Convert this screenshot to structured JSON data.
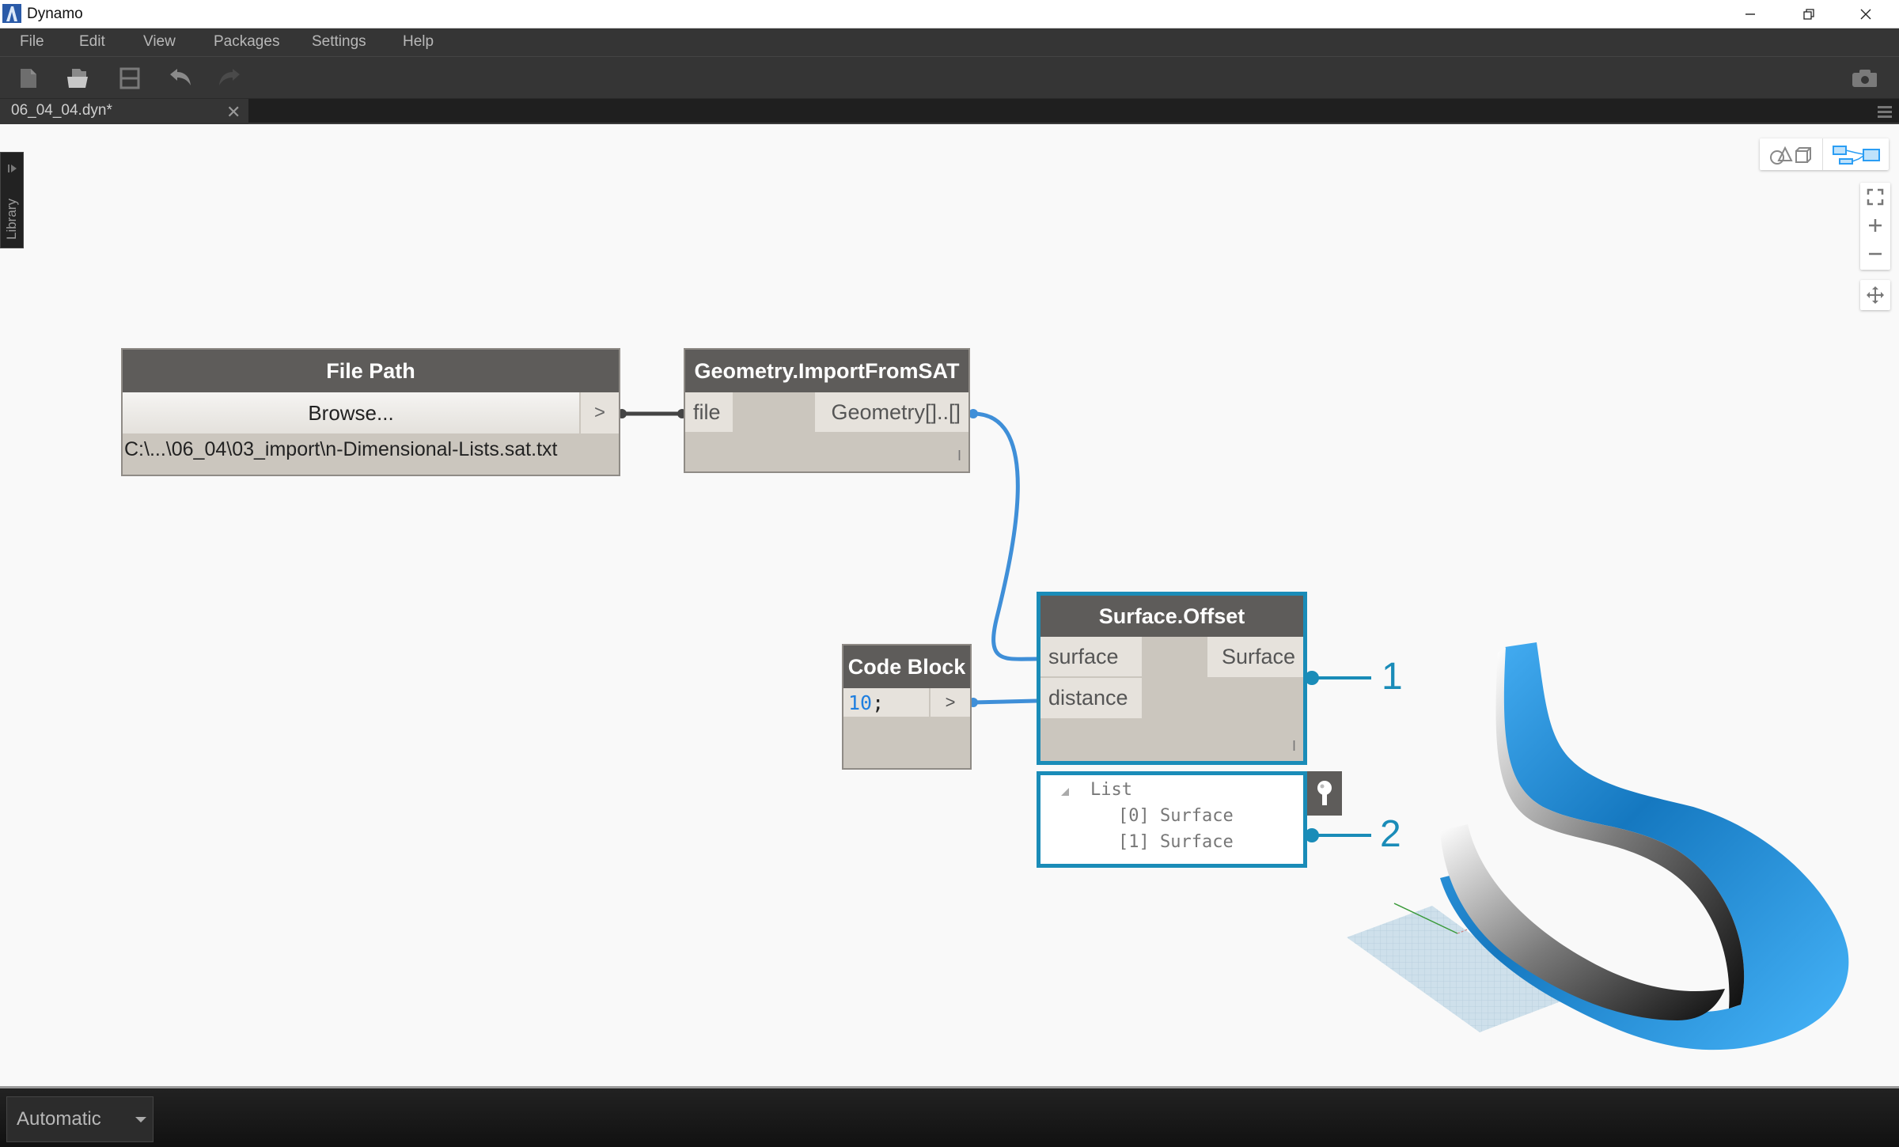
{
  "window": {
    "title": "Dynamo",
    "controls": [
      "minimize",
      "restore",
      "close"
    ]
  },
  "menu": {
    "items": [
      {
        "label": "File"
      },
      {
        "label": "Edit"
      },
      {
        "label": "View"
      },
      {
        "label": "Packages"
      },
      {
        "label": "Settings"
      },
      {
        "label": "Help"
      }
    ]
  },
  "toolbar": {
    "buttons": [
      {
        "icon": "new-file-icon",
        "name": "New"
      },
      {
        "icon": "open-folder-icon",
        "name": "Open"
      },
      {
        "icon": "save-icon",
        "name": "Save"
      },
      {
        "icon": "undo-icon",
        "name": "Undo"
      },
      {
        "icon": "redo-icon",
        "name": "Redo"
      }
    ],
    "right_button": {
      "icon": "camera-icon",
      "name": "Export screenshot"
    }
  },
  "tabs": [
    {
      "label": "06_04_04.dyn*",
      "active": true
    }
  ],
  "library": {
    "label": "Library"
  },
  "canvas_controls": {
    "view_toggle": [
      {
        "icon": "geometry-view-icon",
        "active": false
      },
      {
        "icon": "graph-view-icon",
        "active": true
      }
    ],
    "zoom": [
      {
        "icon": "zoom-fit-icon"
      },
      {
        "icon": "zoom-in-icon",
        "label": "+"
      },
      {
        "icon": "zoom-out-icon",
        "label": "−"
      }
    ],
    "pan": {
      "icon": "pan-icon"
    }
  },
  "nodes": {
    "file_path": {
      "title": "File Path",
      "browse_label": "Browse...",
      "output_label": ">",
      "value": "C:\\...\\06_04\\03_import\\n-Dimensional-Lists.sat.txt"
    },
    "import_sat": {
      "title": "Geometry.ImportFromSAT",
      "inputs": [
        "file"
      ],
      "outputs": [
        "Geometry[]..[]"
      ],
      "lacing": "I"
    },
    "code_block": {
      "title": "Code Block",
      "code_number": "10",
      "code_semicolon": ";",
      "output_label": ">"
    },
    "surface_offset": {
      "title": "Surface.Offset",
      "inputs": [
        "surface",
        "distance"
      ],
      "outputs": [
        "Surface"
      ],
      "lacing": "I",
      "preview": {
        "root": "List",
        "items": [
          "[0] Surface",
          "[1] Surface"
        ]
      }
    }
  },
  "callouts": [
    "1",
    "2"
  ],
  "colors": {
    "accent": "#1a8cb8",
    "wire": "#3f8fd8",
    "node_header": "#5e5c5a",
    "node_body": "#cbc6be",
    "surface_blue": "#3aa6ef"
  },
  "run": {
    "mode": "Automatic"
  }
}
